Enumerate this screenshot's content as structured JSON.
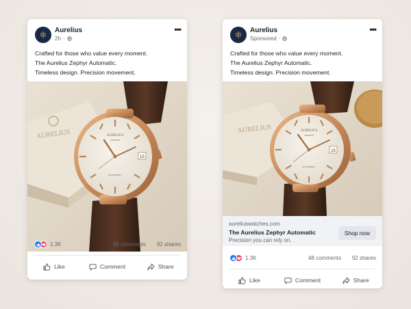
{
  "colors": {
    "avatar_bg": "#182845",
    "avatar_gold": "#c9a15a",
    "like_blue": "#1877f2",
    "love_red": "#f33e58",
    "link_bar_bg": "#f0f2f5"
  },
  "cards": [
    {
      "kind": "organic",
      "brand_name": "Aurelius",
      "meta_time": "2h",
      "meta_icon": "globe-icon",
      "more_icon": "ellipsis-icon",
      "text_lines": [
        "Crafted for those who value every moment.",
        "The Aurelius Zephyr Automatic.",
        "Timeless design. Precision movement."
      ],
      "reaction_count": "1.3K",
      "comments": "48 comments",
      "shares": "92 shares",
      "actions": [
        "Like",
        "Comment",
        "Share"
      ]
    },
    {
      "kind": "sponsored",
      "brand_name": "Aurelius",
      "meta_time": "Sponsored",
      "meta_icon": "globe-icon",
      "more_icon": "ellipsis-icon",
      "text_lines": [
        "Crafted for those who value every moment.",
        "The Aurelius Zephyr Automatic.",
        "Timeless design. Precision movement."
      ],
      "link": {
        "domain": "aureliuswatches.com",
        "title": "The Aurelius Zephyr Automatic",
        "description": "Precision you can rely on.",
        "cta": "Shop now"
      },
      "reaction_count": "1.3K",
      "comments": "48 comments",
      "shares": "92 shares",
      "actions": [
        "Like",
        "Comment",
        "Share"
      ]
    }
  ],
  "watch": {
    "dial_brand": "AURELIUS",
    "dial_sub": "ZEPHYR",
    "dial_auto": "AUTOMATIC",
    "date": "15",
    "box_brand": "AURELIUS"
  }
}
